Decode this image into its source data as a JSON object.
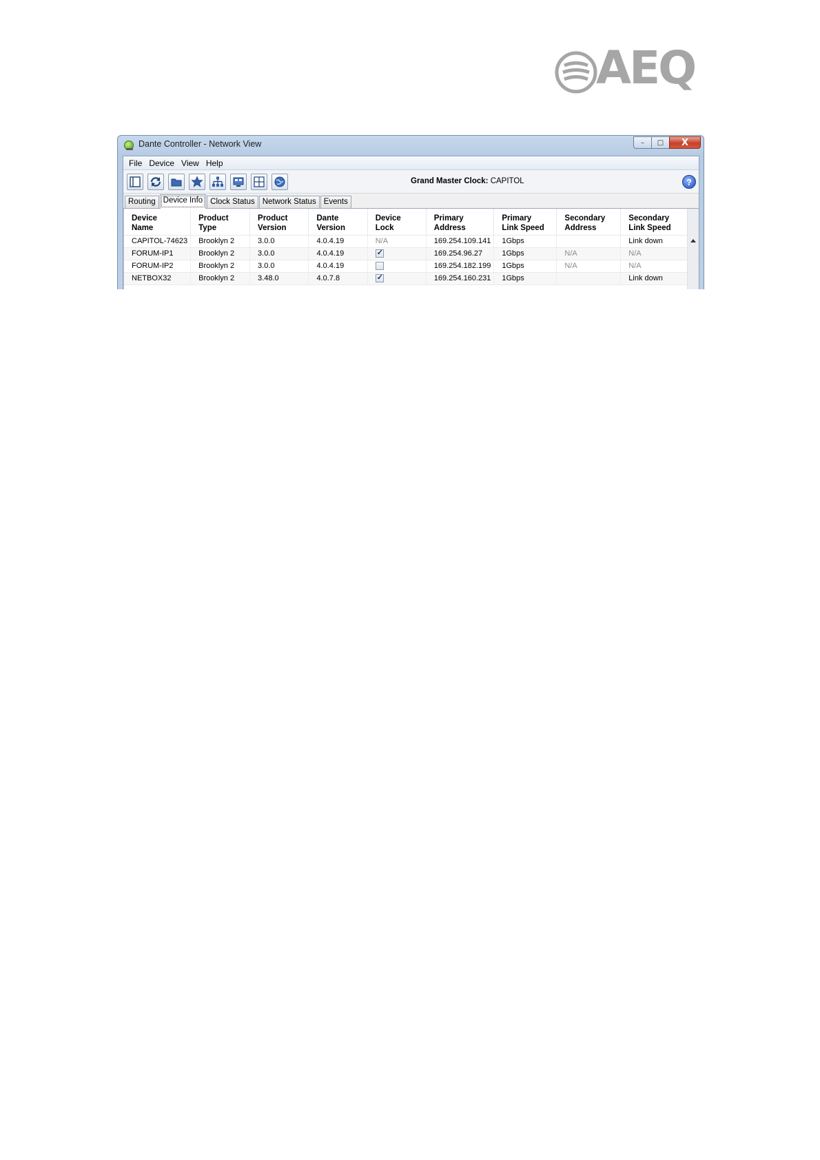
{
  "logo": {
    "text": "AEQ"
  },
  "window": {
    "title": "Dante Controller - Network View",
    "buttons": {
      "minimize": "–",
      "maximize": "□",
      "close": "X"
    }
  },
  "menu": [
    "File",
    "Device",
    "View",
    "Help"
  ],
  "toolbar": {
    "icons": [
      "device-view-icon",
      "refresh-icon",
      "open-folder-icon",
      "favorites-star-icon",
      "network-tree-icon",
      "monitor-icon",
      "add-grid-icon",
      "globe-icon"
    ],
    "gmc_label": "Grand Master Clock:",
    "gmc_value": "CAPITOL",
    "help": "?"
  },
  "tabs": [
    {
      "label": "Routing",
      "active": false
    },
    {
      "label": "Device Info",
      "active": true
    },
    {
      "label": "Clock Status",
      "active": false
    },
    {
      "label": "Network Status",
      "active": false
    },
    {
      "label": "Events",
      "active": false
    }
  ],
  "table": {
    "headers": [
      [
        "Device",
        "Name"
      ],
      [
        "Product",
        "Type"
      ],
      [
        "Product",
        "Version"
      ],
      [
        "Dante",
        "Version"
      ],
      [
        "Device",
        "Lock"
      ],
      [
        "Primary",
        "Address"
      ],
      [
        "Primary",
        "Link Speed"
      ],
      [
        "Secondary",
        "Address"
      ],
      [
        "Secondary",
        "Link Speed"
      ]
    ],
    "rows": [
      {
        "name": "CAPITOL-74623",
        "type": "Brooklyn 2",
        "product_version": "3.0.0",
        "dante_version": "4.0.4.19",
        "lock": "N/A",
        "primary_address": "169.254.109.141",
        "primary_speed": "1Gbps",
        "secondary_address": "",
        "secondary_speed": "Link down"
      },
      {
        "name": "FORUM-IP1",
        "type": "Brooklyn 2",
        "product_version": "3.0.0",
        "dante_version": "4.0.4.19",
        "lock": "checked",
        "primary_address": "169.254.96.27",
        "primary_speed": "1Gbps",
        "secondary_address": "N/A",
        "secondary_speed": "N/A"
      },
      {
        "name": "FORUM-IP2",
        "type": "Brooklyn 2",
        "product_version": "3.0.0",
        "dante_version": "4.0.4.19",
        "lock": "unchecked",
        "primary_address": "169.254.182.199",
        "primary_speed": "1Gbps",
        "secondary_address": "N/A",
        "secondary_speed": "N/A"
      },
      {
        "name": "NETBOX32",
        "type": "Brooklyn 2",
        "product_version": "3.48.0",
        "dante_version": "4.0.7.8",
        "lock": "checked",
        "primary_address": "169.254.160.231",
        "primary_speed": "1Gbps",
        "secondary_address": "",
        "secondary_speed": "Link down"
      }
    ]
  },
  "colors": {
    "logo_gray": "#a6a6a6",
    "title_bar": "#bcd0e8",
    "close_red": "#c7402a"
  }
}
